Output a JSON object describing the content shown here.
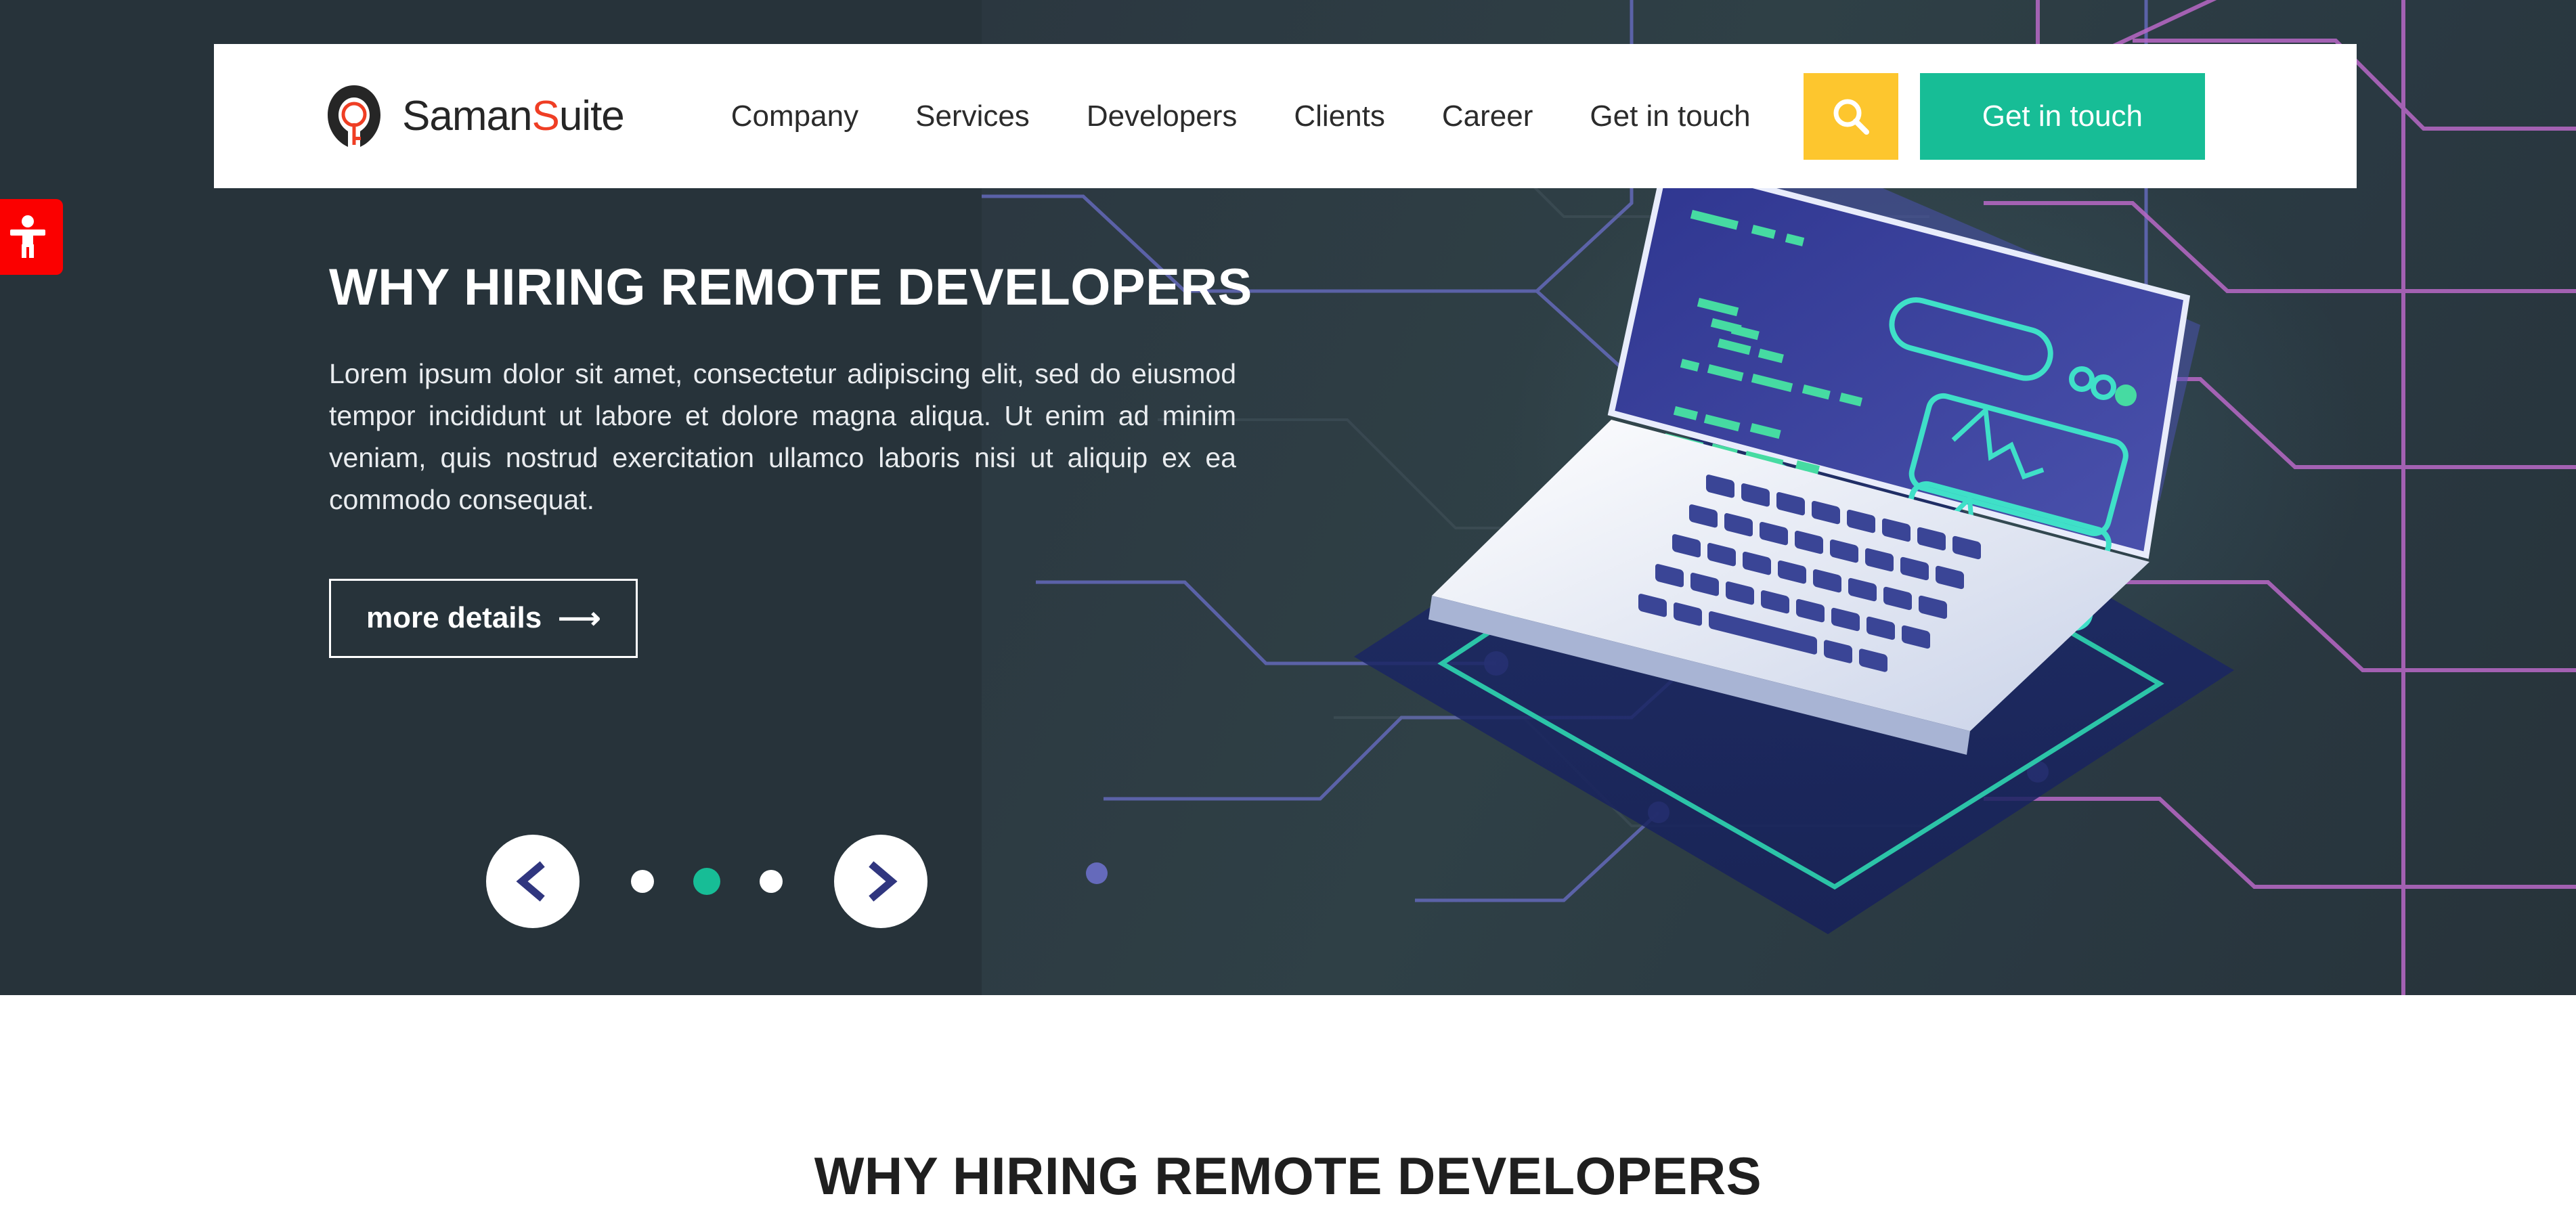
{
  "brand": {
    "name_primary": "Saman",
    "name_accent": "S",
    "name_suffix": "uite",
    "logo_icon": "keyhole-logo-icon"
  },
  "nav": {
    "items": [
      {
        "label": "Company"
      },
      {
        "label": "Services"
      },
      {
        "label": "Developers"
      },
      {
        "label": "Clients"
      },
      {
        "label": "Career"
      },
      {
        "label": "Get in touch"
      }
    ]
  },
  "header_actions": {
    "search_icon": "search-icon",
    "cta_label": "Get in touch"
  },
  "hero": {
    "title": "WHY HIRING REMOTE DEVELOPERS",
    "paragraph": "Lorem ipsum dolor sit amet, consectetur adipiscing elit, sed do eiusmod tempor incididunt ut labore et dolore magna aliqua. Ut enim ad minim veniam, quis nostrud exercitation ullamco laboris nisi ut aliquip ex ea commodo consequat.",
    "more_label": "more details",
    "more_arrow": "⟶",
    "illustration": "isometric-laptop-circuit-illustration"
  },
  "carousel": {
    "prev_icon": "chevron-left-icon",
    "next_icon": "chevron-right-icon",
    "slides": 3,
    "active_index": 1
  },
  "accessibility_widget": {
    "icon": "accessibility-person-icon",
    "color": "#fb0000"
  },
  "section_below": {
    "title": "WHY HIRING REMOTE DEVELOPERS"
  },
  "colors": {
    "hero_bg": "#27333a",
    "header_bg": "#ffffff",
    "accent_teal": "#17bd96",
    "accent_yellow": "#fdc62e",
    "accent_red": "#ef3e24",
    "nav_text": "#2b2b2b",
    "chevron_navy": "#30367f"
  }
}
